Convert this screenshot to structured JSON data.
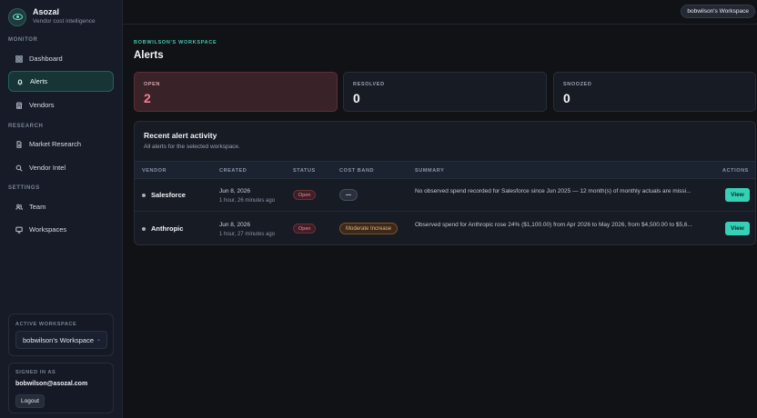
{
  "app": {
    "name": "Asozal",
    "tagline": "Vendor cost intelligence"
  },
  "sidebar": {
    "sections": [
      {
        "label": "MONITOR"
      },
      {
        "label": "RESEARCH"
      },
      {
        "label": "SETTINGS"
      }
    ],
    "items": [
      {
        "label": "Dashboard",
        "icon": "grid-icon"
      },
      {
        "label": "Alerts",
        "icon": "bell-icon",
        "active": true
      },
      {
        "label": "Vendors",
        "icon": "store-icon"
      },
      {
        "label": "Market Research",
        "icon": "document-icon"
      },
      {
        "label": "Vendor Intel",
        "icon": "search-icon"
      },
      {
        "label": "Team",
        "icon": "users-icon"
      },
      {
        "label": "Workspaces",
        "icon": "monitor-icon"
      }
    ],
    "active_workspace": {
      "label": "ACTIVE WORKSPACE",
      "value": "bobwilson's Workspace"
    },
    "signed_in": {
      "label": "SIGNED IN AS",
      "email": "bobwilson@asozal.com",
      "logout_label": "Logout"
    }
  },
  "topbar": {
    "workspace_pill": "bobwilson's Workspace"
  },
  "main": {
    "breadcrumb": "BOBWILSON'S WORKSPACE",
    "title": "Alerts",
    "stats": [
      {
        "label": "OPEN",
        "value": "2"
      },
      {
        "label": "RESOLVED",
        "value": "0"
      },
      {
        "label": "SNOOZED",
        "value": "0"
      }
    ],
    "activity": {
      "title": "Recent alert activity",
      "subtitle": "All alerts for the selected workspace.",
      "columns": [
        "VENDOR",
        "CREATED",
        "STATUS",
        "COST BAND",
        "SUMMARY",
        "ACTIONS"
      ],
      "rows": [
        {
          "vendor": "Salesforce",
          "created_date": "Jun 8, 2026",
          "created_ago": "1 hour, 26 minutes ago",
          "status": "Open",
          "cost_band": "—",
          "summary": "No observed spend recorded for Salesforce since Jun 2025 — 12 month(s) of monthly actuals are missi...",
          "action": "View"
        },
        {
          "vendor": "Anthropic",
          "created_date": "Jun 8, 2026",
          "created_ago": "1 hour, 27 minutes ago",
          "status": "Open",
          "cost_band": "Moderate Increase",
          "summary": "Observed spend for Anthropic rose 24% ($1,100.00) from Apr 2026 to May 2026, from $4,500.00 to $5,6...",
          "action": "View"
        }
      ]
    }
  },
  "colors": {
    "accent": "#35d0b5",
    "danger": "#f37f8a",
    "warning": "#f0b36c"
  }
}
